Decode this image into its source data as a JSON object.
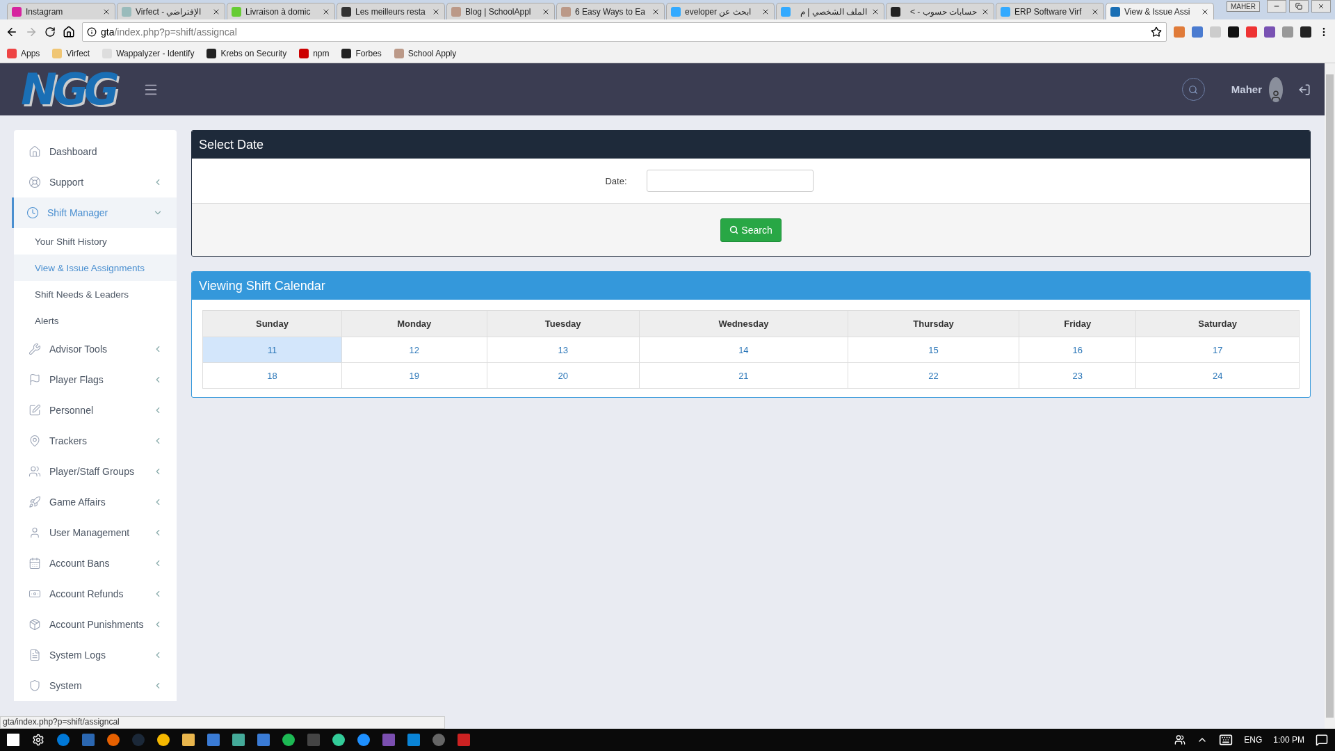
{
  "browser": {
    "tabs": [
      {
        "title": "Instagram",
        "selected": false
      },
      {
        "title": "Virfect - الإفتراضي",
        "selected": false
      },
      {
        "title": "Livraison à domic",
        "selected": false
      },
      {
        "title": "Les meilleurs resta",
        "selected": false
      },
      {
        "title": "Blog | SchoolAppl",
        "selected": false
      },
      {
        "title": "6 Easy Ways to Ea",
        "selected": false
      },
      {
        "title": "eveloper ابحث عن",
        "selected": false
      },
      {
        "title": "الملف الشخصي | م",
        "selected": false
      },
      {
        "title": "حسابات حسوب - >",
        "selected": false
      },
      {
        "title": "ERP Software Virf",
        "selected": false
      },
      {
        "title": "View & Issue Assi",
        "selected": true
      }
    ],
    "profile": "MAHER",
    "url_host": "gta",
    "url_path": "/index.php?p=shift/assigncal",
    "bookmarks": [
      "Apps",
      "Virfect",
      "Wappalyzer - Identify",
      "Krebs on Security",
      "npm",
      "Forbes",
      "School Apply"
    ],
    "status_url": "gta/index.php?p=shift/assigncal"
  },
  "header": {
    "logo": "NGG",
    "user": "Maher"
  },
  "sidebar": {
    "items": [
      {
        "label": "Dashboard",
        "kind": "link",
        "selected": false
      },
      {
        "label": "Support",
        "kind": "group",
        "selected": false,
        "expanded": false
      },
      {
        "label": "Shift Manager",
        "kind": "group",
        "selected": true,
        "expanded": true,
        "children": [
          {
            "label": "Your Shift History",
            "selected": false
          },
          {
            "label": "View & Issue Assignments",
            "selected": true
          },
          {
            "label": "Shift Needs & Leaders",
            "selected": false
          },
          {
            "label": "Alerts",
            "selected": false
          }
        ]
      },
      {
        "label": "Advisor Tools",
        "kind": "group",
        "selected": false,
        "expanded": false
      },
      {
        "label": "Player Flags",
        "kind": "group",
        "selected": false,
        "expanded": false
      },
      {
        "label": "Personnel",
        "kind": "group",
        "selected": false,
        "expanded": false
      },
      {
        "label": "Trackers",
        "kind": "group",
        "selected": false,
        "expanded": false
      },
      {
        "label": "Player/Staff Groups",
        "kind": "group",
        "selected": false,
        "expanded": false
      },
      {
        "label": "Game Affairs",
        "kind": "group",
        "selected": false,
        "expanded": false
      },
      {
        "label": "User Management",
        "kind": "group",
        "selected": false,
        "expanded": false
      },
      {
        "label": "Account Bans",
        "kind": "group",
        "selected": false,
        "expanded": false
      },
      {
        "label": "Account Refunds",
        "kind": "group",
        "selected": false,
        "expanded": false
      },
      {
        "label": "Account Punishments",
        "kind": "group",
        "selected": false,
        "expanded": false
      },
      {
        "label": "System Logs",
        "kind": "group",
        "selected": false,
        "expanded": false
      },
      {
        "label": "System",
        "kind": "group",
        "selected": false,
        "expanded": false
      }
    ]
  },
  "select_date": {
    "title": "Select Date",
    "label": "Date:",
    "button": "Search"
  },
  "calendar": {
    "title": "Viewing Shift Calendar",
    "columns": [
      "Sunday",
      "Monday",
      "Tuesday",
      "Wednesday",
      "Thursday",
      "Friday",
      "Saturday"
    ],
    "rows": [
      [
        {
          "day": "11",
          "selected": true
        },
        {
          "day": "12",
          "selected": false
        },
        {
          "day": "13",
          "selected": false
        },
        {
          "day": "14",
          "selected": false
        },
        {
          "day": "15",
          "selected": false
        },
        {
          "day": "16",
          "selected": false
        },
        {
          "day": "17",
          "selected": false
        }
      ],
      [
        {
          "day": "18",
          "selected": false
        },
        {
          "day": "19",
          "selected": false
        },
        {
          "day": "20",
          "selected": false
        },
        {
          "day": "21",
          "selected": false
        },
        {
          "day": "22",
          "selected": false
        },
        {
          "day": "23",
          "selected": false
        },
        {
          "day": "24",
          "selected": false
        }
      ]
    ]
  },
  "taskbar": {
    "language": "ENG",
    "time": "1:00 PM"
  }
}
